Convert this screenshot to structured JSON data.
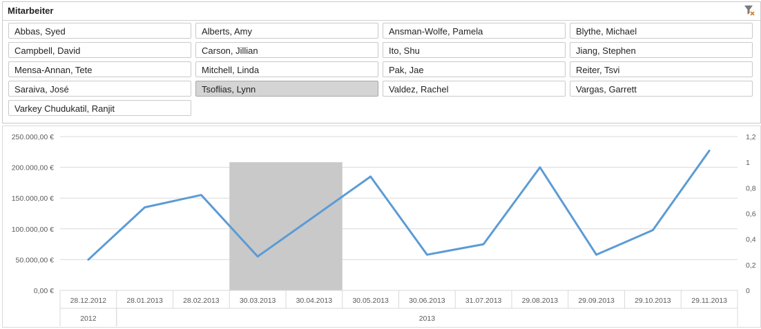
{
  "slicer": {
    "title": "Mitarbeiter",
    "clear_filter_icon": "clear-filter-icon",
    "items": [
      {
        "label": "Abbas, Syed",
        "selected": false
      },
      {
        "label": "Alberts, Amy",
        "selected": false
      },
      {
        "label": "Ansman-Wolfe, Pamela",
        "selected": false
      },
      {
        "label": "Blythe, Michael",
        "selected": false
      },
      {
        "label": "Campbell, David",
        "selected": false
      },
      {
        "label": "Carson, Jillian",
        "selected": false
      },
      {
        "label": "Ito, Shu",
        "selected": false
      },
      {
        "label": "Jiang, Stephen",
        "selected": false
      },
      {
        "label": "Mensa-Annan, Tete",
        "selected": false
      },
      {
        "label": "Mitchell, Linda",
        "selected": false
      },
      {
        "label": "Pak, Jae",
        "selected": false
      },
      {
        "label": "Reiter, Tsvi",
        "selected": false
      },
      {
        "label": "Saraiva, José",
        "selected": false
      },
      {
        "label": "Tsoflias, Lynn",
        "selected": true
      },
      {
        "label": "Valdez, Rachel",
        "selected": false
      },
      {
        "label": "Vargas, Garrett",
        "selected": false
      },
      {
        "label": "Varkey Chudukatil, Ranjit",
        "selected": false
      }
    ]
  },
  "chart_data": {
    "type": "line",
    "categories": [
      "28.12.2012",
      "28.01.2013",
      "28.02.2013",
      "30.03.2013",
      "30.04.2013",
      "30.05.2013",
      "30.06.2013",
      "31.07.2013",
      "29.08.2013",
      "29.09.2013",
      "29.10.2013",
      "29.11.2013"
    ],
    "year_groups": [
      {
        "label": "2012",
        "count": 1
      },
      {
        "label": "2013",
        "count": 11
      }
    ],
    "series": [
      {
        "values": [
          50000,
          135000,
          155000,
          55000,
          120000,
          185000,
          58000,
          75000,
          200000,
          58000,
          98000,
          227000
        ],
        "color": "#5b9bd5"
      }
    ],
    "highlight": {
      "categories": [
        "30.03.2013",
        "30.04.2013"
      ],
      "value": 1,
      "color": "#c9c9c9",
      "axis": "secondary"
    },
    "y_ticks": [
      "0,00 €",
      "50.000,00 €",
      "100.000,00 €",
      "150.000,00 €",
      "200.000,00 €",
      "250.000,00 €"
    ],
    "ylim": [
      0,
      250000
    ],
    "y2_ticks": [
      "0",
      "0,2",
      "0,4",
      "0,6",
      "0,8",
      "1",
      "1,2"
    ],
    "y2lim": [
      0,
      1.2
    ],
    "grid": true
  }
}
